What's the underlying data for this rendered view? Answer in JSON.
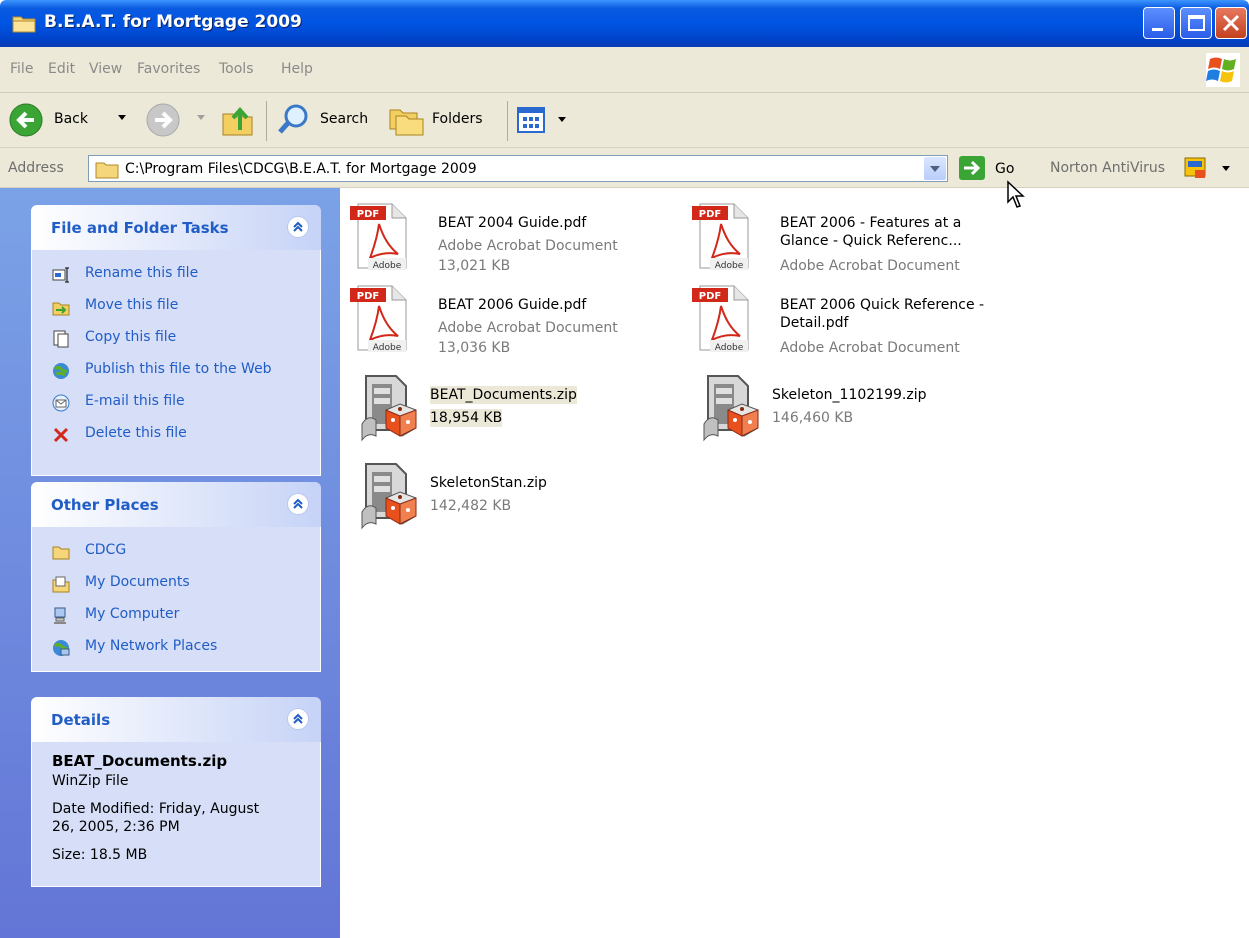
{
  "window": {
    "title": "B.E.A.T. for Mortgage 2009"
  },
  "menu": [
    "File",
    "Edit",
    "View",
    "Favorites",
    "Tools",
    "Help"
  ],
  "toolbar": {
    "back_label": "Back",
    "search_label": "Search",
    "folders_label": "Folders"
  },
  "address": {
    "label": "Address",
    "path": "C:\\Program Files\\CDCG\\B.E.A.T. for Mortgage 2009",
    "go_label": "Go",
    "norton_label": "Norton AntiVirus"
  },
  "tasks_panel": {
    "title": "File and Folder Tasks",
    "items": [
      {
        "label": "Rename this file",
        "icon": "rename-icon"
      },
      {
        "label": "Move this file",
        "icon": "move-icon"
      },
      {
        "label": "Copy this file",
        "icon": "copy-icon"
      },
      {
        "label": "Publish this file to the Web",
        "icon": "publish-icon"
      },
      {
        "label": "E-mail this file",
        "icon": "email-icon"
      },
      {
        "label": "Delete this file",
        "icon": "delete-icon"
      }
    ]
  },
  "places_panel": {
    "title": "Other Places",
    "items": [
      {
        "label": "CDCG",
        "icon": "folder-icon"
      },
      {
        "label": "My Documents",
        "icon": "my-documents-icon"
      },
      {
        "label": "My Computer",
        "icon": "my-computer-icon"
      },
      {
        "label": "My Network Places",
        "icon": "network-places-icon"
      }
    ]
  },
  "details_panel": {
    "title": "Details",
    "name": "BEAT_Documents.zip",
    "type": "WinZip File",
    "modified_line1": "Date Modified: Friday, August",
    "modified_line2": "26, 2005, 2:36 PM",
    "size": "Size: 18.5 MB"
  },
  "files": [
    {
      "name": "BEAT 2004 Guide.pdf",
      "type": "Adobe Acrobat Document",
      "size": "13,021 KB",
      "kind": "pdf"
    },
    {
      "name1": "BEAT 2006 - Features at a",
      "name2": "Glance - Quick Referenc...",
      "type": "Adobe Acrobat Document",
      "kind": "pdf"
    },
    {
      "name": "BEAT 2006 Guide.pdf",
      "type": "Adobe Acrobat Document",
      "size": "13,036 KB",
      "kind": "pdf"
    },
    {
      "name1": "BEAT 2006 Quick Reference -",
      "name2": "Detail.pdf",
      "type": "Adobe Acrobat Document",
      "kind": "pdf"
    },
    {
      "name": "BEAT_Documents.zip",
      "size": "18,954 KB",
      "kind": "zip",
      "selected": true
    },
    {
      "name": "Skeleton_1102199.zip",
      "size": "146,460 KB",
      "kind": "zip"
    },
    {
      "name": "SkeletonStan.zip",
      "size": "142,482 KB",
      "kind": "zip"
    }
  ],
  "pdf_icon_text": {
    "badge": "PDF",
    "brand": "Adobe"
  },
  "colors": {
    "titlebar": "#0054e3",
    "task_link": "#215dc6",
    "pane_bg": "#6f8fe0",
    "selection": "#ebe8d8"
  }
}
